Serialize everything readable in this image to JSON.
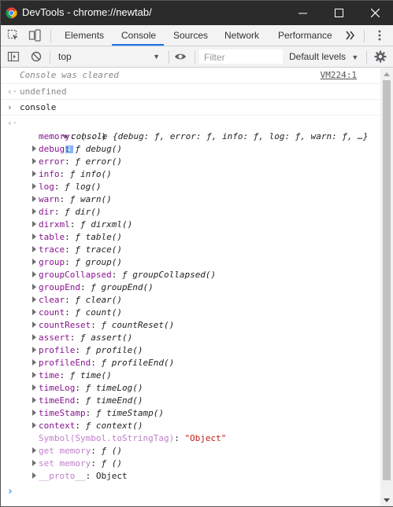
{
  "window": {
    "title": "DevTools - chrome://newtab/"
  },
  "tabs": [
    "Elements",
    "Console",
    "Sources",
    "Network",
    "Performance"
  ],
  "toolbar": {
    "context": "top",
    "filter_placeholder": "Filter",
    "levels": "Default levels"
  },
  "messages": {
    "cleared": "Console was cleared",
    "cleared_src": "VM224:1",
    "undefined": "undefined",
    "input": "console",
    "summary": "console {debug: ƒ, error: ƒ, info: ƒ, log: ƒ, warn: ƒ, …}"
  },
  "props": [
    {
      "k": "memory",
      "v": "(...)",
      "plain": true,
      "noarrow": true
    },
    {
      "k": "debug",
      "v": "debug()"
    },
    {
      "k": "error",
      "v": "error()"
    },
    {
      "k": "info",
      "v": "info()"
    },
    {
      "k": "log",
      "v": "log()"
    },
    {
      "k": "warn",
      "v": "warn()"
    },
    {
      "k": "dir",
      "v": "dir()"
    },
    {
      "k": "dirxml",
      "v": "dirxml()"
    },
    {
      "k": "table",
      "v": "table()"
    },
    {
      "k": "trace",
      "v": "trace()"
    },
    {
      "k": "group",
      "v": "group()"
    },
    {
      "k": "groupCollapsed",
      "v": "groupCollapsed()"
    },
    {
      "k": "groupEnd",
      "v": "groupEnd()"
    },
    {
      "k": "clear",
      "v": "clear()"
    },
    {
      "k": "count",
      "v": "count()"
    },
    {
      "k": "countReset",
      "v": "countReset()"
    },
    {
      "k": "assert",
      "v": "assert()"
    },
    {
      "k": "profile",
      "v": "profile()"
    },
    {
      "k": "profileEnd",
      "v": "profileEnd()"
    },
    {
      "k": "time",
      "v": "time()"
    },
    {
      "k": "timeLog",
      "v": "timeLog()"
    },
    {
      "k": "timeEnd",
      "v": "timeEnd()"
    },
    {
      "k": "timeStamp",
      "v": "timeStamp()"
    },
    {
      "k": "context",
      "v": "context()"
    }
  ],
  "tail": {
    "symbol_key": "Symbol(Symbol.toStringTag)",
    "symbol_val": "\"Object\"",
    "get_memory": "get memory",
    "set_memory": "set memory",
    "fn_empty": "()",
    "proto_key": "__proto__",
    "proto_val": "Object"
  },
  "colors": {
    "accent": "#1a73e8",
    "key": "#881391",
    "string": "#c41a16"
  }
}
